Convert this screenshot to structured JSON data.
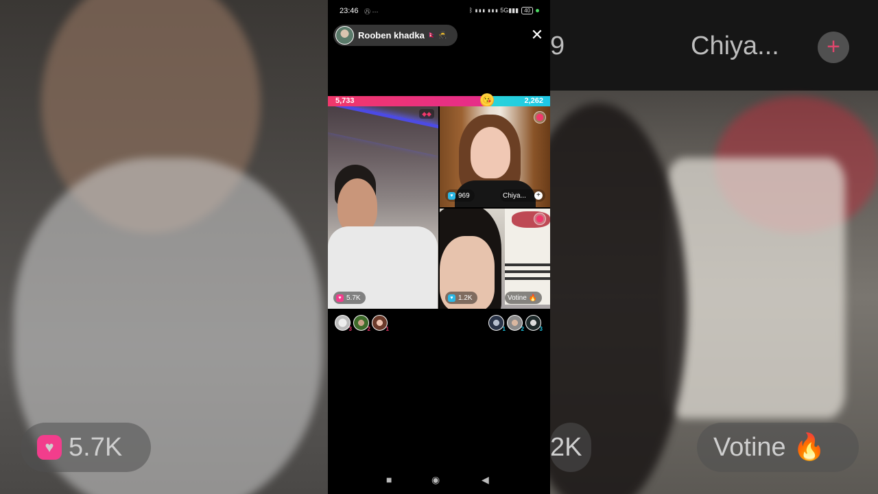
{
  "status_bar": {
    "time": "23:46",
    "left_icons": "㊇ ···",
    "signal_text": "ᛒ ▮▮▮ ▮▮▮ 5G▮▮▮",
    "battery": "40"
  },
  "host": {
    "name": "Rooben khadka",
    "badges": "🇳🇵 🥷"
  },
  "battle": {
    "left_score": "5,733",
    "right_score": "2,262",
    "left_color": "#f0386b",
    "right_color": "#1ec8e6"
  },
  "tiles": {
    "main": {
      "score": "5.7K"
    },
    "top_right": {
      "score": "969",
      "name": "Chiya..."
    },
    "bottom_right": {
      "score": "1.2K",
      "name": "Votine 🔥"
    }
  },
  "gifters_left": [
    {
      "rank": "3"
    },
    {
      "rank": "2"
    },
    {
      "rank": "1"
    }
  ],
  "gifters_right": [
    {
      "rank": "1"
    },
    {
      "rank": "2"
    },
    {
      "rank": "3"
    }
  ],
  "background": {
    "right_top_text": "Chiya...",
    "right_top_partial": "9",
    "left_bottom_score": "5.7K",
    "right_bottom_name": "Votine 🔥",
    "right_bottom_partial": "2K"
  }
}
